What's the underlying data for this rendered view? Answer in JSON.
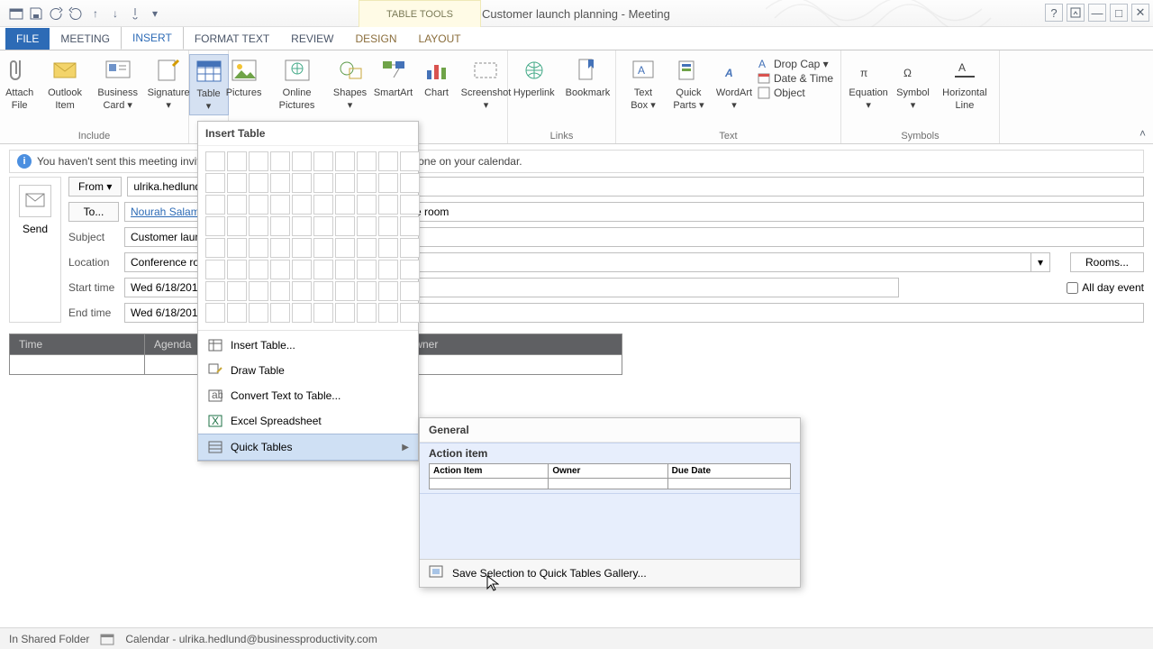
{
  "window": {
    "title": "Customer launch planning - Meeting",
    "tabletools": "TABLE TOOLS"
  },
  "tabs": {
    "file": "FILE",
    "meeting": "MEETING",
    "insert": "INSERT",
    "format_text": "FORMAT TEXT",
    "review": "REVIEW",
    "design": "DESIGN",
    "layout": "LAYOUT"
  },
  "ribbon": {
    "include": {
      "attach_file": "Attach File",
      "outlook_item": "Outlook Item",
      "business_card": "Business Card ▾",
      "signature": "Signature ▾",
      "group": "Include"
    },
    "tables": {
      "table": "Table ▾"
    },
    "illustrations": {
      "pictures": "Pictures",
      "online_pictures": "Online Pictures",
      "shapes": "Shapes ▾",
      "smartart": "SmartArt",
      "chart": "Chart",
      "screenshot": "Screenshot ▾"
    },
    "links": {
      "hyperlink": "Hyperlink",
      "bookmark": "Bookmark",
      "group": "Links"
    },
    "text": {
      "textbox": "Text Box ▾",
      "quickparts": "Quick Parts ▾",
      "wordart": "WordArt ▾",
      "dropcap": "Drop Cap ▾",
      "datetime": "Date & Time",
      "object": "Object",
      "group": "Text"
    },
    "symbols": {
      "equation": "Equation ▾",
      "symbol": "Symbol ▾",
      "hline": "Horizontal Line",
      "group": "Symbols"
    }
  },
  "info": {
    "text": "You haven't sent this meeting invitation yet.  This appointment is next to another one on your calendar."
  },
  "compose": {
    "send": "Send",
    "from_label": "From ▾",
    "from_value": "ulrika.hedlund@businessproductivity.com",
    "to_label": "To...",
    "to_value": "Nourah Salameh",
    "conf_text": "erence room",
    "subject_label": "Subject",
    "subject_value": "Customer launch planning",
    "location_label": "Location",
    "location_value": "Conference room",
    "rooms": "Rooms...",
    "start_label": "Start time",
    "start_date": "Wed 6/18/2014",
    "end_label": "End time",
    "end_date": "Wed 6/18/2014",
    "allday": "All day event"
  },
  "doc_table": {
    "time": "Time",
    "agenda": "Agenda",
    "owner": "Owner"
  },
  "dropdown": {
    "title": "Insert Table",
    "insert_table": "Insert Table...",
    "draw_table": "Draw Table",
    "convert": "Convert Text to Table...",
    "excel": "Excel Spreadsheet",
    "quick_tables": "Quick Tables"
  },
  "quicktables": {
    "general": "General",
    "preview_name": "Action item",
    "cols": {
      "a": "Action Item",
      "b": "Owner",
      "c": "Due Date"
    },
    "save": "Save Selection to Quick Tables Gallery..."
  },
  "status": {
    "folder": "In Shared Folder",
    "path": "Calendar - ulrika.hedlund@businessproductivity.com"
  }
}
